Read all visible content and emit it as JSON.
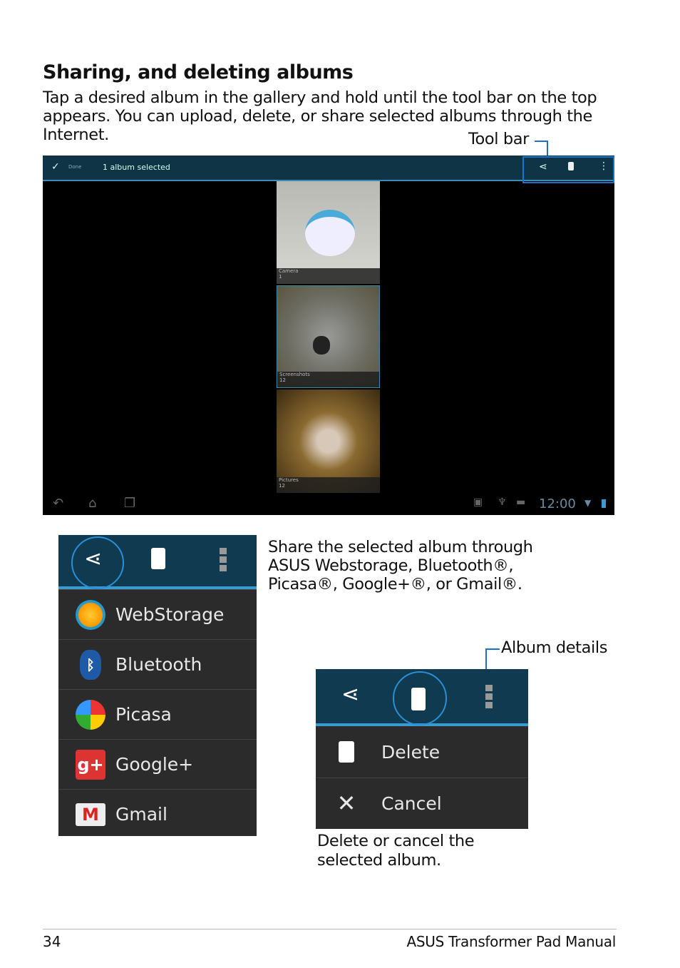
{
  "title": "Sharing, and deleting albums",
  "intro": "Tap a desired album in the gallery and hold until the tool bar on the top appears. You can upload, delete, or share selected albums through the Internet.",
  "toolbar_label": "Tool bar",
  "screen": {
    "done_label": "Done",
    "selection": "1 album selected",
    "albums": [
      {
        "name": "Camera",
        "count": "1"
      },
      {
        "name": "Screenshots",
        "count": "12"
      },
      {
        "name": "Pictures",
        "count": "12"
      }
    ],
    "clock": "12:00"
  },
  "share": {
    "description": "Share the selected album through ASUS Webstorage, Bluetooth®, Picasa®, Google+®, or Gmail®.",
    "items": [
      {
        "label": "WebStorage",
        "icon": "webstorage-icon"
      },
      {
        "label": "Bluetooth",
        "icon": "bluetooth-icon"
      },
      {
        "label": "Picasa",
        "icon": "picasa-icon"
      },
      {
        "label": "Google+",
        "icon": "googleplus-icon"
      },
      {
        "label": "Gmail",
        "icon": "gmail-icon"
      }
    ]
  },
  "album_details_label": "Album details",
  "delete": {
    "items": [
      {
        "label": "Delete",
        "icon": "trash-icon"
      },
      {
        "label": "Cancel",
        "icon": "close-icon"
      }
    ],
    "description": "Delete or cancel the selected album."
  },
  "footer": {
    "page": "34",
    "manual": "ASUS Transformer Pad Manual"
  }
}
